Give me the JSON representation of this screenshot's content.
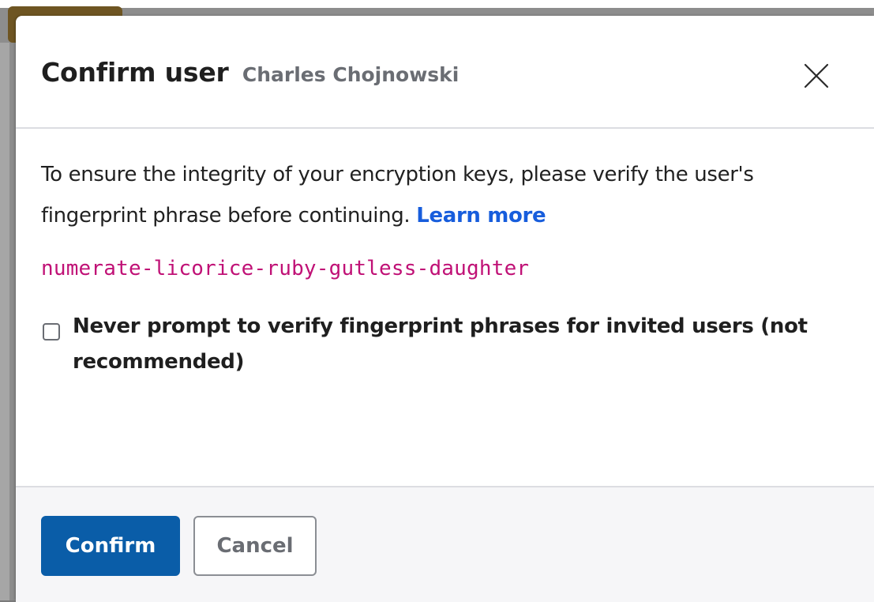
{
  "modal": {
    "title": "Confirm user",
    "subtitle": "Charles Chojnowski",
    "body_text": "To ensure the integrity of your encryption keys, please verify the user's fingerprint phrase before continuing.",
    "learn_more_link": "Learn more",
    "fingerprint_phrase": "numerate-licorice-ruby-gutless-daughter",
    "checkbox": {
      "label": "Never prompt to verify fingerprint phrases for invited users (not recommended)",
      "checked": false
    },
    "confirm_button": "Confirm",
    "cancel_button": "Cancel",
    "close_icon": "close-icon"
  },
  "colors": {
    "primary": "#0a5da8",
    "link": "#175ddc",
    "fingerprint": "#c01176",
    "muted": "#6a6d73"
  }
}
